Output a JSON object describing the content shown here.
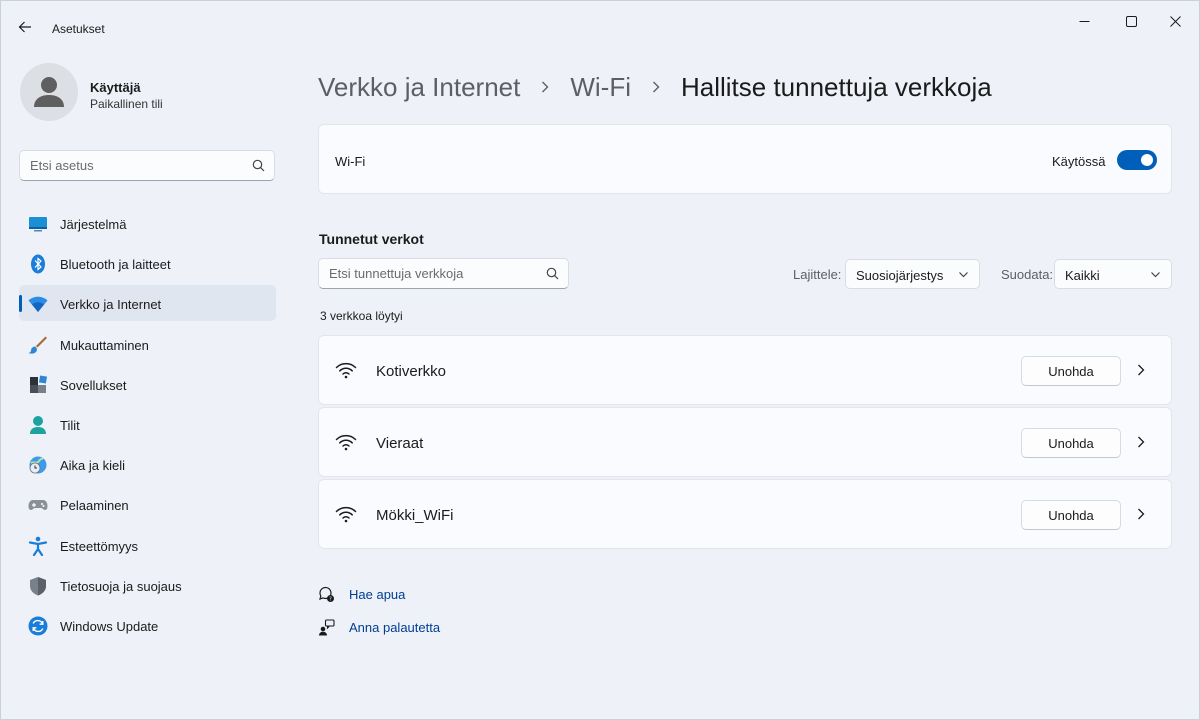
{
  "app": {
    "title": "Asetukset"
  },
  "profile": {
    "name": "Käyttäjä",
    "subtitle": "Paikallinen tili"
  },
  "sidebar": {
    "search_placeholder": "Etsi asetus",
    "items": [
      {
        "label": "Järjestelmä",
        "icon": "system-icon"
      },
      {
        "label": "Bluetooth ja laitteet",
        "icon": "bluetooth-icon"
      },
      {
        "label": "Verkko ja Internet",
        "icon": "wifi-icon",
        "selected": true
      },
      {
        "label": "Mukauttaminen",
        "icon": "brush-icon"
      },
      {
        "label": "Sovellukset",
        "icon": "apps-icon"
      },
      {
        "label": "Tilit",
        "icon": "account-icon"
      },
      {
        "label": "Aika ja kieli",
        "icon": "globe-clock-icon"
      },
      {
        "label": "Pelaaminen",
        "icon": "gamepad-icon"
      },
      {
        "label": "Esteettömyys",
        "icon": "accessibility-icon"
      },
      {
        "label": "Tietosuoja ja suojaus",
        "icon": "shield-icon"
      },
      {
        "label": "Windows Update",
        "icon": "update-icon"
      }
    ]
  },
  "breadcrumb": {
    "items": [
      "Verkko ja Internet",
      "Wi-Fi"
    ],
    "current": "Hallitse tunnettuja verkkoja"
  },
  "wifi": {
    "label": "Wi-Fi",
    "state_label": "Käytössä",
    "enabled": true
  },
  "known_networks": {
    "title": "Tunnetut verkot",
    "search_placeholder": "Etsi tunnettuja verkkoja",
    "sort_label": "Lajittele:",
    "sort_value": "Suosiojärjestys",
    "filter_label": "Suodata:",
    "filter_value": "Kaikki",
    "count_text": "3 verkkoa löytyi",
    "forget_label": "Unohda",
    "networks": [
      {
        "name": "Kotiverkko"
      },
      {
        "name": "Vieraat"
      },
      {
        "name": "Mökki_WiFi"
      }
    ]
  },
  "links": {
    "help": "Hae apua",
    "feedback": "Anna palautetta"
  },
  "colors": {
    "accent": "#005fb8",
    "link": "#003e92",
    "background": "#eef2f8",
    "card": "#f9fbfe"
  }
}
